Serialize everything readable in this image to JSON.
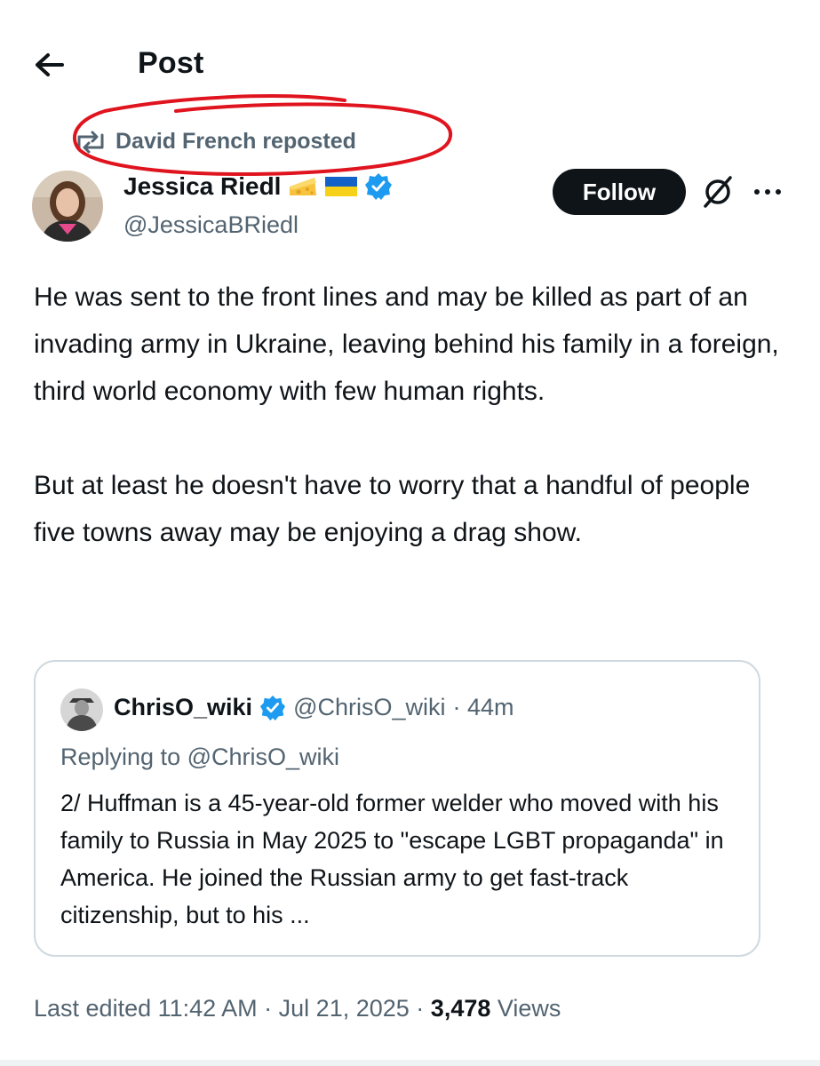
{
  "header": {
    "title": "Post",
    "back_icon": "arrow-left-icon"
  },
  "repost": {
    "text": "David French reposted",
    "icon": "repost-icon"
  },
  "author": {
    "name": "Jessica Riedl",
    "handle": "@JessicaBRiedl",
    "badges": [
      "cheese-emoji",
      "ukraine-flag",
      "verified-badge"
    ]
  },
  "actions": {
    "follow_label": "Follow",
    "grok_icon": "grok-icon",
    "more_icon": "more-dots-icon"
  },
  "post": {
    "paragraphs": [
      "He was sent to the front lines and may be killed as part of an invading army in Ukraine, leaving behind his family in a foreign, third world economy with few human rights.",
      "But at least he doesn't have to worry that a handful of people five towns away may be enjoying a drag show."
    ]
  },
  "quote": {
    "name": "ChrisO_wiki",
    "handle": "@ChrisO_wiki",
    "time": "· 44m",
    "replying_prefix": "Replying to",
    "replying_to": "@ChrisO_wiki",
    "text": "2/ Huffman is a 45-year-old former welder who moved with his family to Russia in May 2025 to \"escape LGBT propaganda\" in America. He joined the Russian army to get fast-track citizenship, but to his ..."
  },
  "meta": {
    "edited": "Last edited 11:42 AM · Jul 21, 2025 ·",
    "views_count": "3,478",
    "views_label": "Views"
  },
  "colors": {
    "text_primary": "#0f1419",
    "text_secondary": "#536471",
    "verified_blue": "#1d9bf0",
    "annotation_red": "#e0141e",
    "border": "#cfd9de"
  }
}
